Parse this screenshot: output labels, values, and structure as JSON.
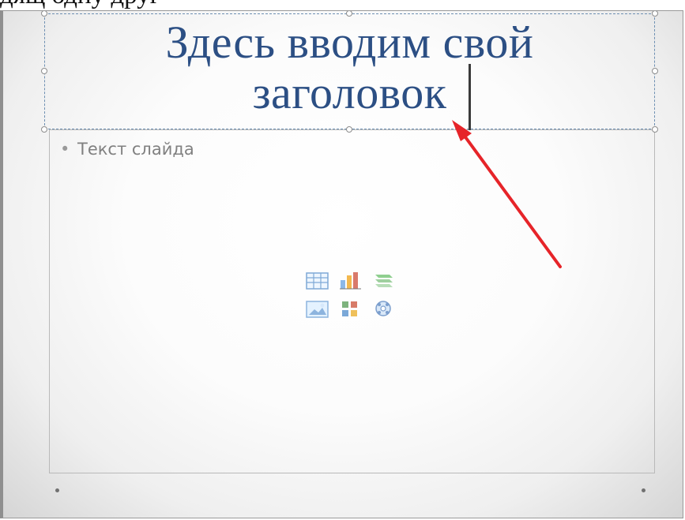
{
  "document": {
    "top_text": "дящ одну друг"
  },
  "slide": {
    "title_lines": [
      "Здесь вводим свой",
      "заголовок"
    ],
    "body_bullet": "•",
    "body_text": "Текст слайда",
    "content_icons": [
      "table-icon",
      "chart-icon",
      "smartart-icon",
      "picture-icon",
      "clipart-icon",
      "media-icon"
    ]
  },
  "colors": {
    "title": "#2c4f84",
    "body_text": "#808080",
    "placeholder_border": "#6d8fb2",
    "annotation_arrow": "#e62429"
  }
}
